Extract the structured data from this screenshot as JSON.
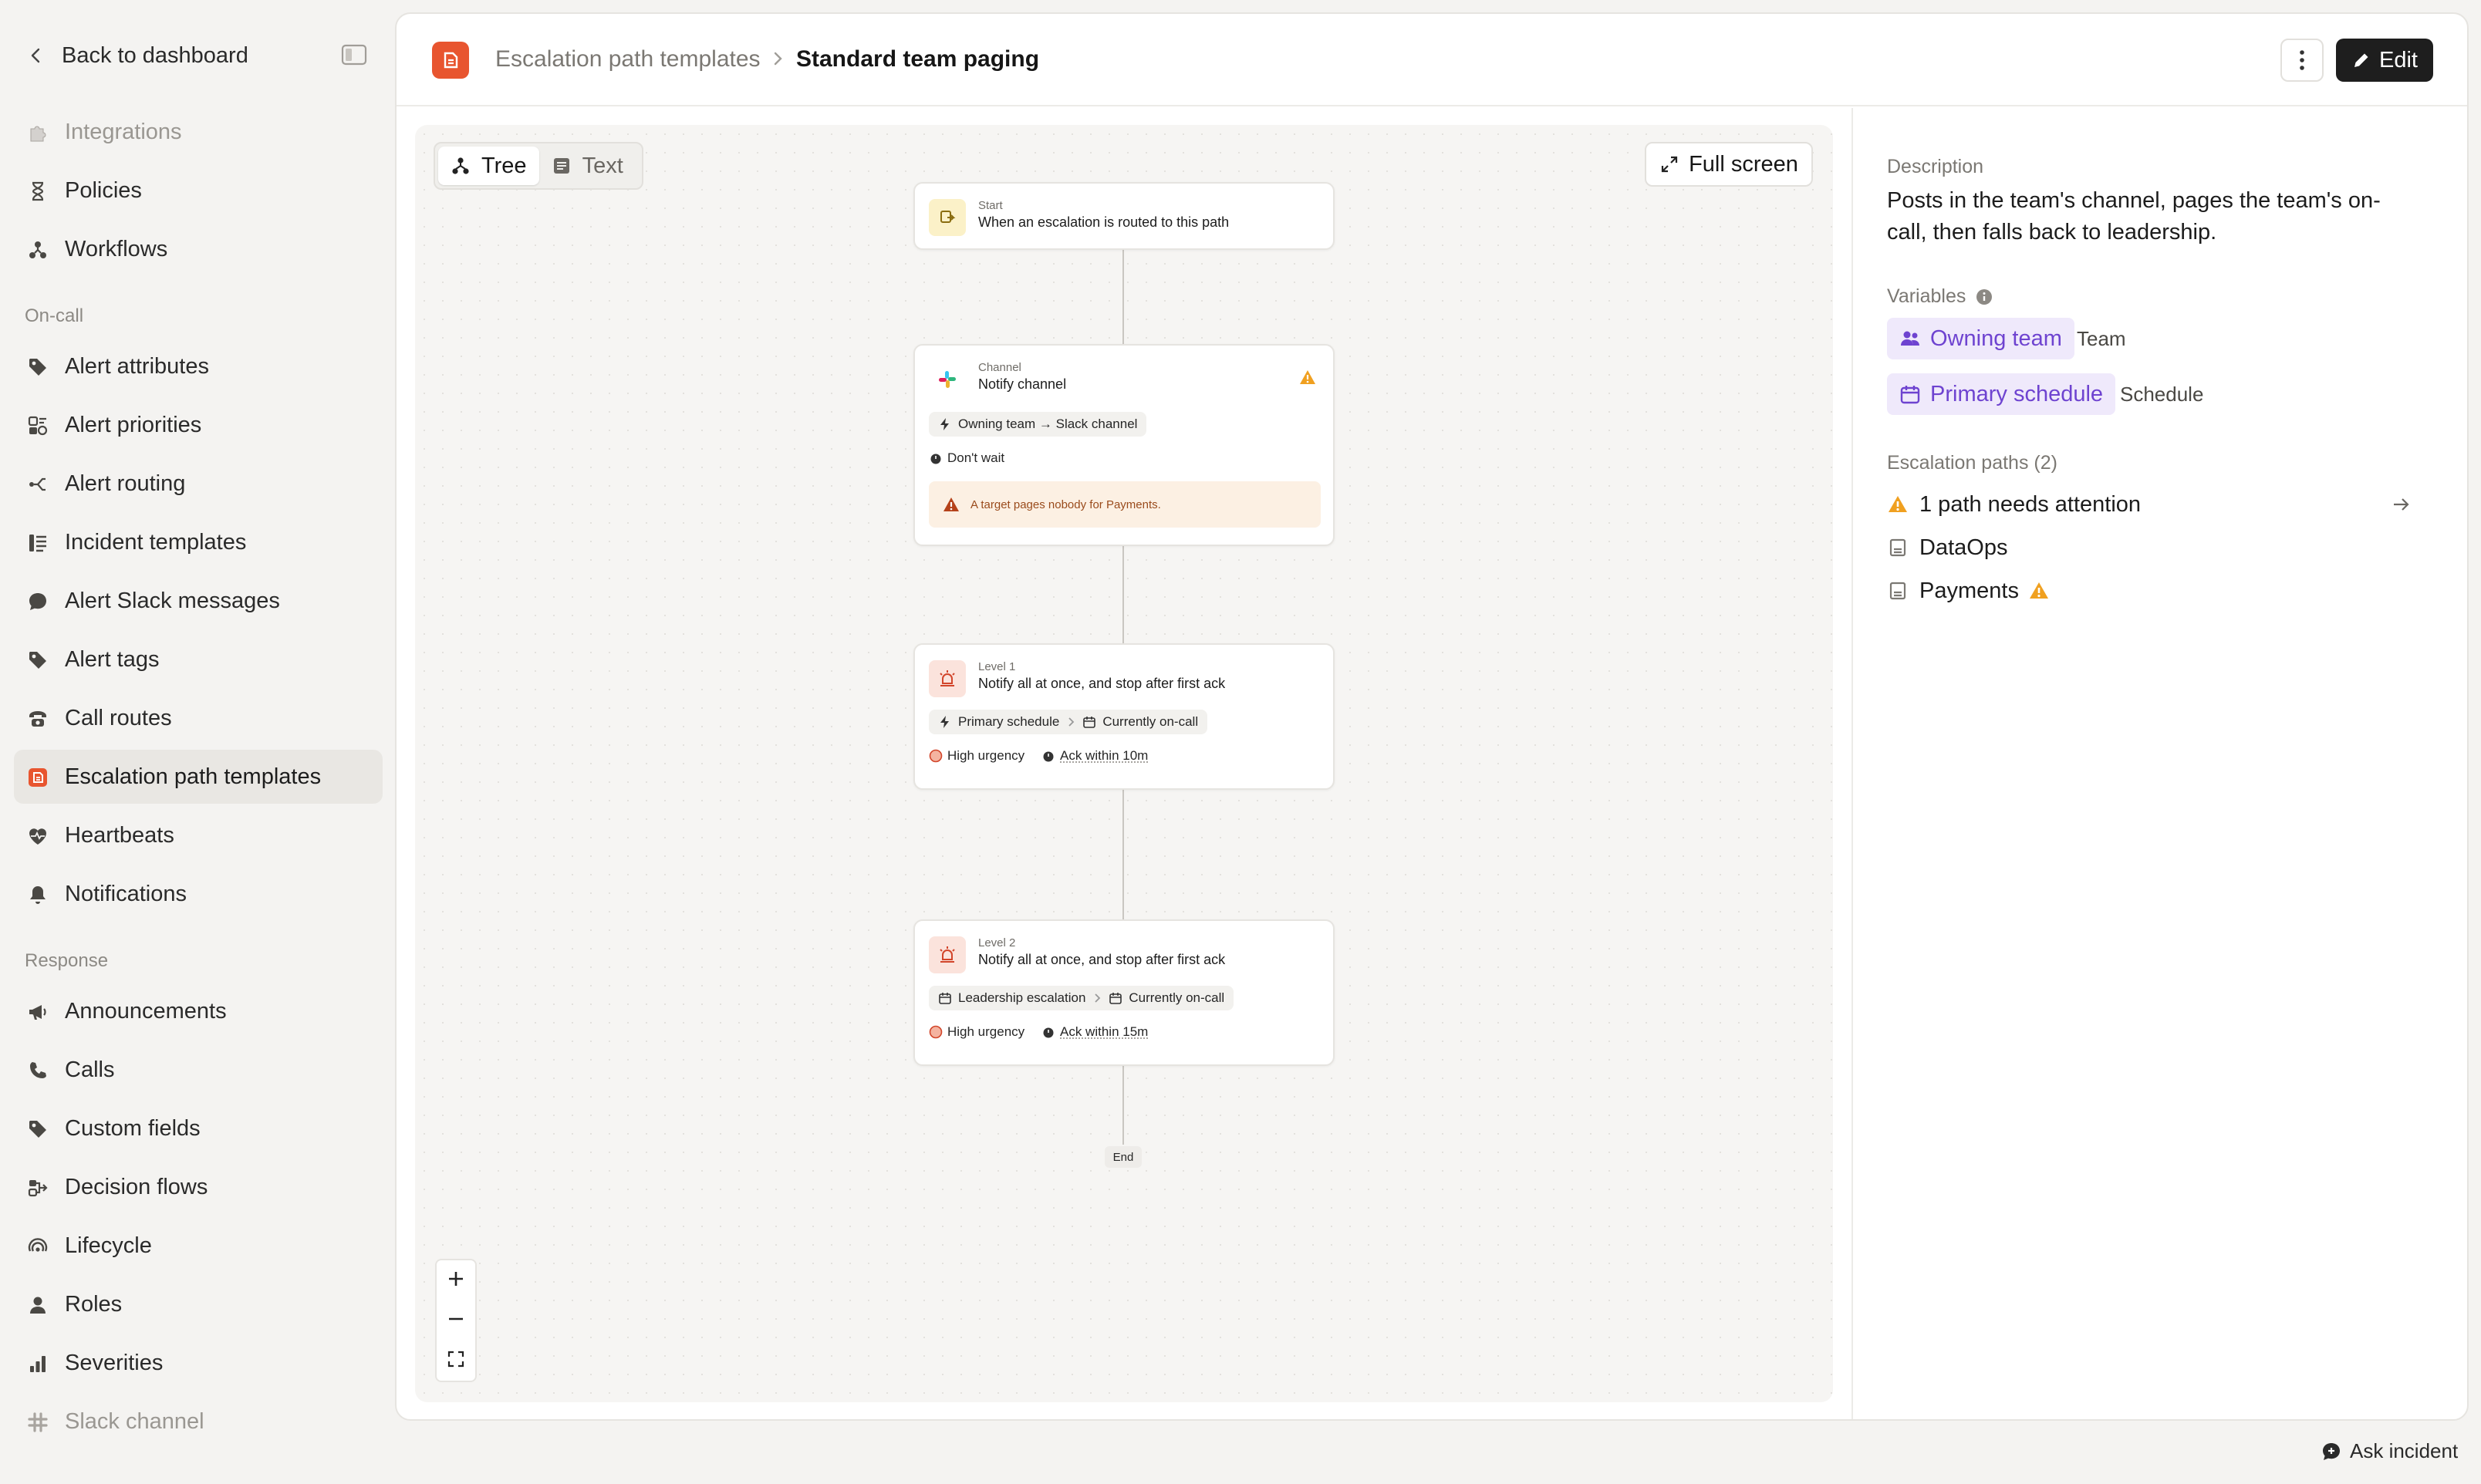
{
  "sidebar": {
    "back_label": "Back to dashboard",
    "top_items": [
      {
        "label": "Integrations",
        "icon": "puzzle-icon"
      },
      {
        "label": "Policies",
        "icon": "hourglass-icon"
      },
      {
        "label": "Workflows",
        "icon": "workflow-icon"
      }
    ],
    "oncall_label": "On-call",
    "oncall_items": [
      {
        "label": "Alert attributes",
        "icon": "tag-icon"
      },
      {
        "label": "Alert priorities",
        "icon": "priority-icon"
      },
      {
        "label": "Alert routing",
        "icon": "routing-icon"
      },
      {
        "label": "Incident templates",
        "icon": "list-icon"
      },
      {
        "label": "Alert Slack messages",
        "icon": "chat-icon"
      },
      {
        "label": "Alert tags",
        "icon": "tag-icon"
      },
      {
        "label": "Call routes",
        "icon": "phone-icon"
      },
      {
        "label": "Escalation path templates",
        "icon": "escalation-icon"
      },
      {
        "label": "Heartbeats",
        "icon": "heartbeat-icon"
      },
      {
        "label": "Notifications",
        "icon": "bell-icon"
      }
    ],
    "response_label": "Response",
    "response_items": [
      {
        "label": "Announcements",
        "icon": "megaphone-icon"
      },
      {
        "label": "Calls",
        "icon": "phone-icon"
      },
      {
        "label": "Custom fields",
        "icon": "tag-icon"
      },
      {
        "label": "Decision flows",
        "icon": "flow-icon"
      },
      {
        "label": "Lifecycle",
        "icon": "lifecycle-icon"
      },
      {
        "label": "Roles",
        "icon": "person-icon"
      },
      {
        "label": "Severities",
        "icon": "bars-icon"
      },
      {
        "label": "Slack channel",
        "icon": "slack-icon"
      }
    ]
  },
  "header": {
    "crumb_parent": "Escalation path templates",
    "crumb_current": "Standard team paging",
    "edit_label": "Edit"
  },
  "canvas": {
    "view_tree": "Tree",
    "view_text": "Text",
    "fullscreen_label": "Full screen",
    "start": {
      "kicker": "Start",
      "title": "When an escalation is routed to this path"
    },
    "channel": {
      "kicker": "Channel",
      "title": "Notify channel",
      "chip": "Owning team → Slack channel",
      "wait": "Don't wait",
      "warning": "A target pages nobody for Payments."
    },
    "level1": {
      "kicker": "Level 1",
      "title": "Notify all at once, and stop after first ack",
      "target": "Primary schedule",
      "target_sub": "Currently on-call",
      "urgency": "High urgency",
      "ack": "Ack within 10m"
    },
    "level2": {
      "kicker": "Level 2",
      "title": "Notify all at once, and stop after first ack",
      "target": "Leadership escalation",
      "target_sub": "Currently on-call",
      "urgency": "High urgency",
      "ack": "Ack within 15m"
    },
    "end_label": "End"
  },
  "details": {
    "description_label": "Description",
    "description": "Posts in the team's channel, pages the team's on-call, then falls back to leadership.",
    "variables_label": "Variables",
    "variables": [
      {
        "name": "Owning team",
        "type": "Team"
      },
      {
        "name": "Primary schedule",
        "type": "Schedule"
      }
    ],
    "paths_label": "Escalation paths (2)",
    "attention": "1 path needs attention",
    "paths": [
      "DataOps",
      "Payments"
    ]
  },
  "footer": {
    "ask_label": "Ask incident"
  },
  "colors": {
    "accent": "#e8552f",
    "variable": "#6e43d0",
    "warning": "#f0a020"
  }
}
